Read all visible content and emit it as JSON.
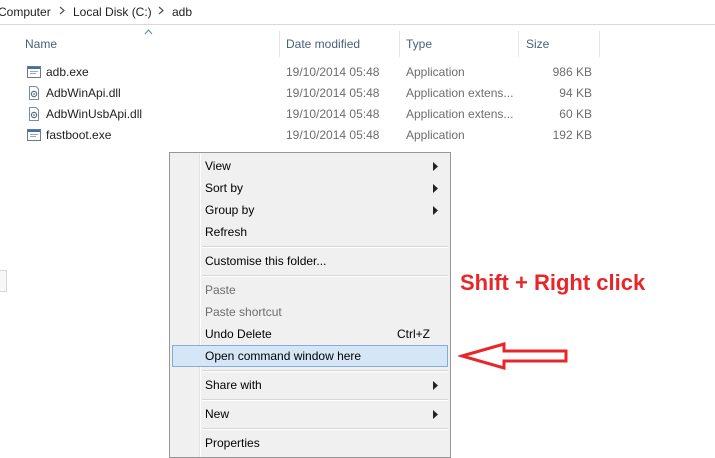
{
  "breadcrumb": {
    "items": [
      "Computer",
      "Local Disk (C:)",
      "adb"
    ]
  },
  "columns": {
    "name": "Name",
    "date_modified": "Date modified",
    "type": "Type",
    "size": "Size"
  },
  "files": [
    {
      "name": "adb.exe",
      "date": "19/10/2014 05:48",
      "type": "Application",
      "size": "986 KB",
      "icon": "exe-icon"
    },
    {
      "name": "AdbWinApi.dll",
      "date": "19/10/2014 05:48",
      "type": "Application extens...",
      "size": "94 KB",
      "icon": "dll-icon"
    },
    {
      "name": "AdbWinUsbApi.dll",
      "date": "19/10/2014 05:48",
      "type": "Application extens...",
      "size": "60 KB",
      "icon": "dll-icon"
    },
    {
      "name": "fastboot.exe",
      "date": "19/10/2014 05:48",
      "type": "Application",
      "size": "192 KB",
      "icon": "exe-icon"
    }
  ],
  "context_menu": {
    "view": "View",
    "sort_by": "Sort by",
    "group_by": "Group by",
    "refresh": "Refresh",
    "customise": "Customise this folder...",
    "paste": "Paste",
    "paste_shortcut": "Paste shortcut",
    "undo_delete": "Undo Delete",
    "undo_shortcut": "Ctrl+Z",
    "open_command": "Open command window here",
    "share_with": "Share with",
    "new": "New",
    "properties": "Properties"
  },
  "annotation": {
    "text": "Shift + Right click",
    "color": "#e8262a"
  },
  "colors": {
    "highlight_bg": "#d5e6f7",
    "highlight_border": "#84acdd",
    "menu_bg": "#f0f0f0",
    "header_text": "#4c607a"
  }
}
